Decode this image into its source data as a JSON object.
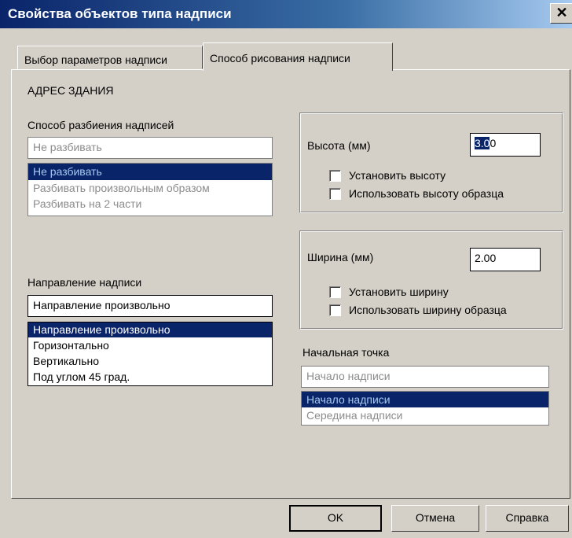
{
  "window": {
    "title": "Свойства объектов типа надписи",
    "close_glyph": "✕"
  },
  "tabs": [
    {
      "label": "Выбор параметров надписи"
    },
    {
      "label": "Способ рисования надписи"
    }
  ],
  "object_name": "АДРЕС ЗДАНИЯ",
  "split_mode": {
    "label": "Способ разбиения надписей",
    "value": "Не разбивать",
    "options": [
      "Не разбивать",
      "Разбивать произвольным образом",
      "Разбивать на 2 части"
    ]
  },
  "direction": {
    "label": "Направление надписи",
    "value": "Направление произвольно",
    "options": [
      "Направление произвольно",
      "Горизонтально",
      "Вертикально",
      "Под углом 45 град."
    ]
  },
  "height_group": {
    "label": "Высота (мм)",
    "value_selected": "3.0",
    "value_rest": "0",
    "set_label": "Установить высоту",
    "sample_label": "Использовать высоту образца"
  },
  "width_group": {
    "label": "Ширина (мм)",
    "value": "2.00",
    "set_label": "Установить ширину",
    "sample_label": "Использовать ширину образца"
  },
  "start_point": {
    "label": "Начальная точка",
    "value": "Начало надписи",
    "options": [
      "Начало надписи",
      "Середина надписи"
    ]
  },
  "buttons": {
    "ok": "OK",
    "cancel": "Отмена",
    "help": "Справка"
  },
  "colors": {
    "titlebar": "#0a246a",
    "selection": "#0a246a",
    "face": "#d4d0c8"
  }
}
